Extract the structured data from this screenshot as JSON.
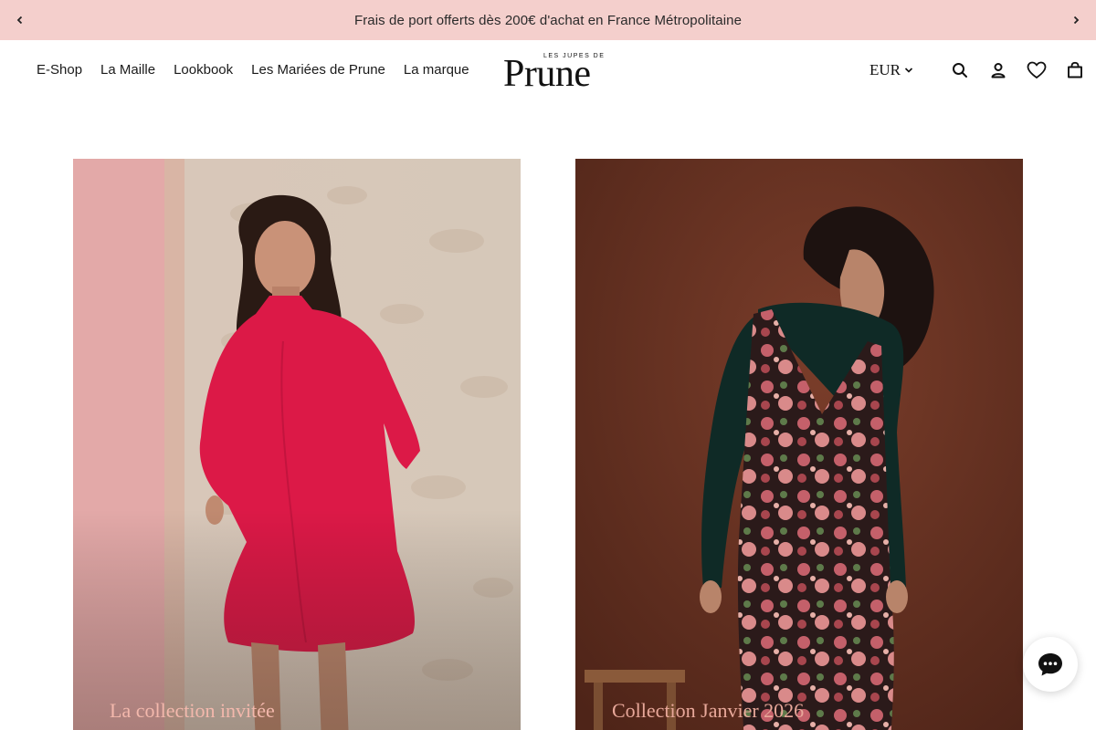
{
  "announcement": {
    "text": "Frais de port offerts dès 200€ d'achat en France Métropolitaine"
  },
  "nav": {
    "items": [
      {
        "label": "E-Shop"
      },
      {
        "label": "La Maille"
      },
      {
        "label": "Lookbook"
      },
      {
        "label": "Les Mariées de Prune"
      },
      {
        "label": "La marque"
      }
    ]
  },
  "logo": {
    "small": "LES JUPES DE",
    "big": "Prune"
  },
  "tools": {
    "currency": "EUR",
    "icons": [
      "search-icon",
      "account-icon",
      "heart-icon",
      "bag-icon"
    ]
  },
  "cards": [
    {
      "title": "La collection invitée"
    },
    {
      "title": "Collection Janvier 2026"
    }
  ],
  "colors": {
    "announcement_bg": "#f4cfcc",
    "card_title": "#f3b8ac",
    "left_card_bg": "#d9c6b5",
    "right_card_bg": "#6b3424",
    "dress": "#dc1947"
  }
}
